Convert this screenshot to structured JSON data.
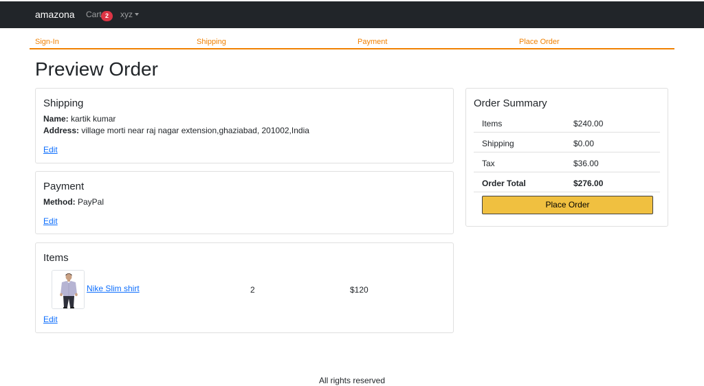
{
  "navbar": {
    "brand": "amazona",
    "cart_label": "Cart",
    "cart_count": "2",
    "user_label": "xyz"
  },
  "steps": [
    "Sign-In",
    "Shipping",
    "Payment",
    "Place Order"
  ],
  "page_title": "Preview Order",
  "shipping": {
    "title": "Shipping",
    "name_label": "Name:",
    "name_value": " kartik kumar",
    "address_label": "Address:",
    "address_value": " village morti near raj nagar extension,ghaziabad, 201002,India",
    "edit_label": "Edit"
  },
  "payment": {
    "title": "Payment",
    "method_label": "Method:",
    "method_value": " PayPal",
    "edit_label": "Edit"
  },
  "items": {
    "title": "Items",
    "list": [
      {
        "name": "Nike Slim shirt",
        "quantity": "2",
        "price": "$120"
      }
    ],
    "edit_label": "Edit"
  },
  "summary": {
    "title": "Order Summary",
    "rows": [
      {
        "label": "Items",
        "value": "$240.00"
      },
      {
        "label": "Shipping",
        "value": "$0.00"
      },
      {
        "label": "Tax",
        "value": "$36.00"
      },
      {
        "label": "Order Total",
        "value": "$276.00"
      }
    ],
    "button_label": "Place Order"
  },
  "footer": "All rights reserved",
  "colors": {
    "navbar": "#212529",
    "step_active": "#f08000",
    "badge": "#dc3545",
    "link": "#0d6efd",
    "primary_button": "#f0c040"
  }
}
